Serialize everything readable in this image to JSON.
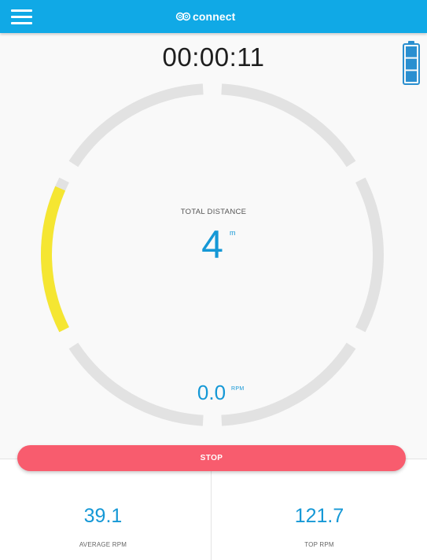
{
  "header": {
    "brand": "connect",
    "menu_icon": "hamburger-menu-icon",
    "logo_icon": "infinity-logo-icon",
    "color": "#10a9e6"
  },
  "timer": {
    "elapsed": "00:00:11"
  },
  "battery": {
    "icon": "battery-icon",
    "filled_segments": 3,
    "total_segments": 3,
    "color": "#2a8fd0"
  },
  "gauge": {
    "progress_fraction": 0.14,
    "track_color": "#e2e2e2",
    "progress_color": "#f5e632",
    "distance_label": "TOTAL DISTANCE",
    "distance_value": "4",
    "distance_unit": "m",
    "rpm_value": "0.0",
    "rpm_unit": "RPM"
  },
  "actions": {
    "stop_label": "STOP",
    "stop_color": "#f85c6e"
  },
  "stats": {
    "average_rpm_value": "39.1",
    "average_rpm_label": "AVERAGE RPM",
    "top_rpm_value": "121.7",
    "top_rpm_label": "TOP RPM"
  }
}
